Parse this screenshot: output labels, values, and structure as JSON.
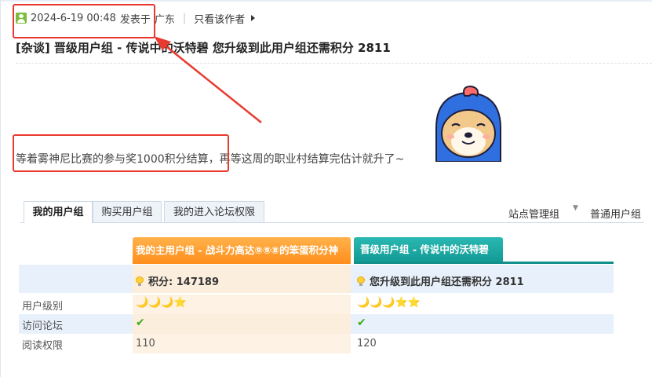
{
  "post": {
    "date": "2024-6-19 00:48",
    "posted_at_label": "发表于",
    "location": "广东",
    "separator": "|",
    "only_author_label": "只看该作者",
    "title": "[杂谈] 晋级用户组 - 传说中的沃特碧 您升级到此用户组还需积分 2811",
    "body": "等着雾神尼比赛的参与奖1000积分结算，再等这周的职业村结算完估计就升了~"
  },
  "tabs": {
    "items": [
      "我的用户组",
      "购买用户组",
      "我的进入论坛权限"
    ],
    "active_index": 0,
    "right_links": [
      "站点管理组",
      "普通用户组"
    ],
    "right_caret": "▼"
  },
  "groups": {
    "main": {
      "header": "我的主用户组 - 战斗力高达⑨⑨⑧的笨蛋积分神",
      "points": "积分: 147189",
      "level_icons": "🌙🌙🌙⭐",
      "visit": "✔",
      "read_perm": "110"
    },
    "upgrade": {
      "header": "晋级用户组 - 传说中的沃特碧",
      "points": "您升级到此用户组还需积分 2811",
      "level_icons": "🌙🌙🌙⭐⭐",
      "visit": "✔",
      "read_perm": "120"
    }
  },
  "row_labels": {
    "level": "用户级别",
    "visit": "访问论坛",
    "read": "阅读权限"
  },
  "colors": {
    "annotation": "#e83a2f",
    "main_header": "#ff8e1c",
    "upgrade_header": "#129a95",
    "check": "#3caa1c"
  }
}
